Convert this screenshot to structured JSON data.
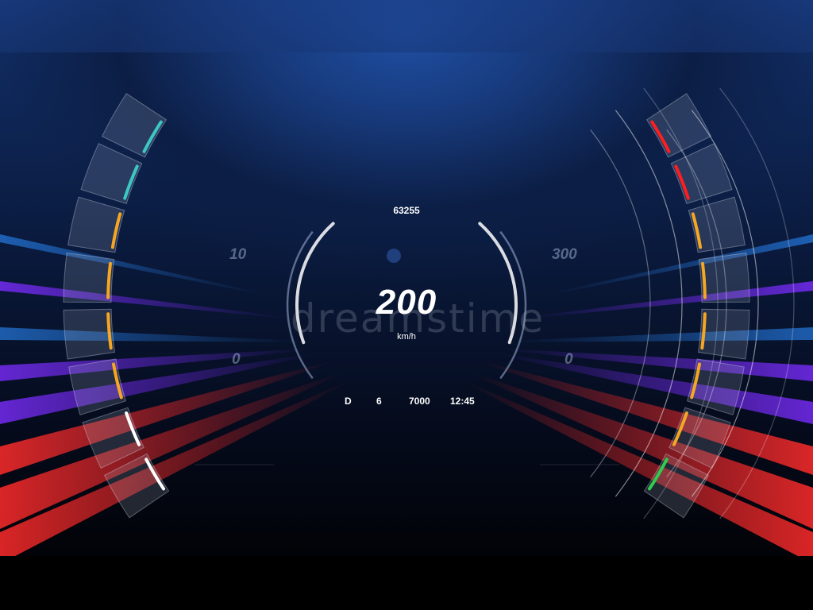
{
  "trip": {
    "odometer": "63255"
  },
  "speed": {
    "value": "200",
    "unit": "km/h"
  },
  "left_gauge": {
    "scale_top": "10",
    "scale_bottom": "0",
    "lit_level": 1.0
  },
  "right_gauge": {
    "scale_top": "300",
    "scale_bottom": "0",
    "lit_level": 1.0
  },
  "status": {
    "gear": "D",
    "gear_number": "6",
    "rpm": "7000",
    "clock": "12:45"
  },
  "watermark": "dreamstime",
  "colors": {
    "background_top": "#1f4fa3",
    "background_bottom": "#02040a",
    "segment_white": "#ffffff",
    "segment_orange": "#f5a623",
    "segment_teal": "#3cc7c4",
    "segment_red": "#ff1e1e",
    "segment_green": "#2ecc4f",
    "light_streak_red": "#ff2b2b",
    "light_streak_purple": "#7b2cff",
    "light_streak_blue": "#2a8cff"
  },
  "left_segment_colors": [
    "white",
    "white",
    "orange",
    "orange",
    "orange",
    "orange",
    "teal",
    "teal"
  ],
  "right_segment_colors": [
    "red",
    "red",
    "orange",
    "orange",
    "orange",
    "orange",
    "orange",
    "green"
  ]
}
